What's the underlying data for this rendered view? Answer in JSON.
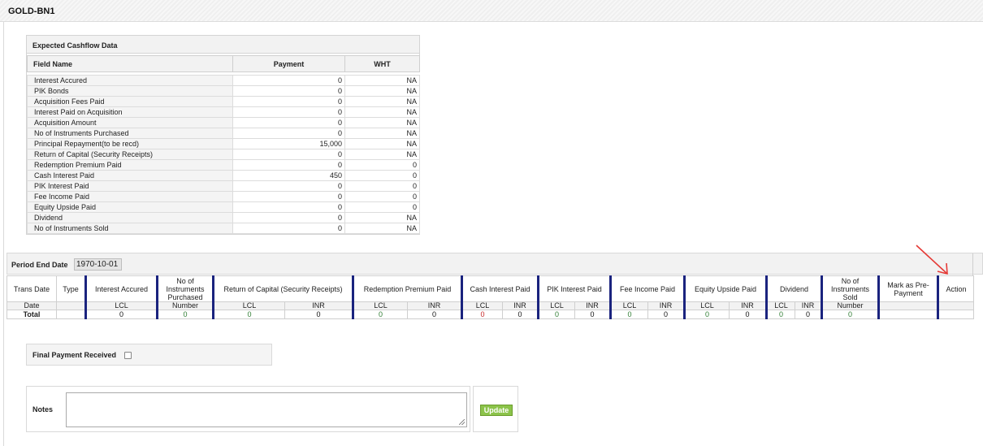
{
  "header": {
    "title": "GOLD-BN1"
  },
  "expected_cashflow": {
    "title": "Expected Cashflow Data",
    "columns": [
      "Field Name",
      "Payment",
      "WHT"
    ],
    "rows": [
      [
        "Interest Accured",
        "0",
        "NA"
      ],
      [
        "PIK Bonds",
        "0",
        "NA"
      ],
      [
        "Acquisition Fees Paid",
        "0",
        "NA"
      ],
      [
        "Interest Paid on Acquisition",
        "0",
        "NA"
      ],
      [
        "Acquisition Amount",
        "0",
        "NA"
      ],
      [
        "No of Instruments Purchased",
        "0",
        "NA"
      ],
      [
        "Principal Repayment(to be recd)",
        "15,000",
        "NA"
      ],
      [
        "Return of Capital (Security Receipts)",
        "0",
        "NA"
      ],
      [
        "Redemption Premium Paid",
        "0",
        "0"
      ],
      [
        "Cash Interest Paid",
        "450",
        "0"
      ],
      [
        "PIK Interest Paid",
        "0",
        "0"
      ],
      [
        "Fee Income Paid",
        "0",
        "0"
      ],
      [
        "Equity Upside Paid",
        "0",
        "0"
      ],
      [
        "Dividend",
        "0",
        "NA"
      ],
      [
        "No of Instruments Sold",
        "0",
        "NA"
      ]
    ]
  },
  "period": {
    "label": "Period End Date",
    "value": "1970-10-01"
  },
  "transactions": {
    "headers": {
      "trans_date": "Trans Date",
      "type": "Type",
      "interest_accured": "Interest Accured",
      "instr_purchased": "No of Instruments Purchased",
      "return_capital": "Return of Capital (Security Receipts)",
      "redemption": "Redemption Premium Paid",
      "cash_interest": "Cash Interest Paid",
      "pik_interest": "PIK Interest Paid",
      "fee_income": "Fee Income Paid",
      "equity_upside": "Equity Upside Paid",
      "dividend": "Dividend",
      "instr_sold": "No of Instruments Sold",
      "mark_prepay": "Mark as Pre-Payment",
      "action": "Action"
    },
    "sub": {
      "date": "Date",
      "lcl": "LCL",
      "inr": "INR",
      "number": "Number"
    },
    "total": {
      "label": "Total",
      "interest_accured": "0",
      "instr_purchased": "0",
      "return_capital_lcl": "0",
      "return_capital_inr": "0",
      "redemption_lcl": "0",
      "redemption_inr": "0",
      "cash_interest_lcl": "0",
      "cash_interest_inr": "0",
      "pik_lcl": "0",
      "pik_inr": "0",
      "fee_lcl": "0",
      "fee_inr": "0",
      "equity_lcl": "0",
      "equity_inr": "0",
      "dividend_lcl": "0",
      "dividend_inr": "0",
      "instr_sold": "0"
    }
  },
  "final_payment": {
    "label": "Final Payment Received",
    "checked": false
  },
  "notes": {
    "label": "Notes",
    "value": ""
  },
  "update_button": {
    "label": "Update"
  },
  "colors": {
    "accent_border": "#1a237e",
    "update_green": "#8bc34a",
    "value_green": "#2e7d32",
    "value_red": "#c62828",
    "annotation_red": "#e53935"
  }
}
